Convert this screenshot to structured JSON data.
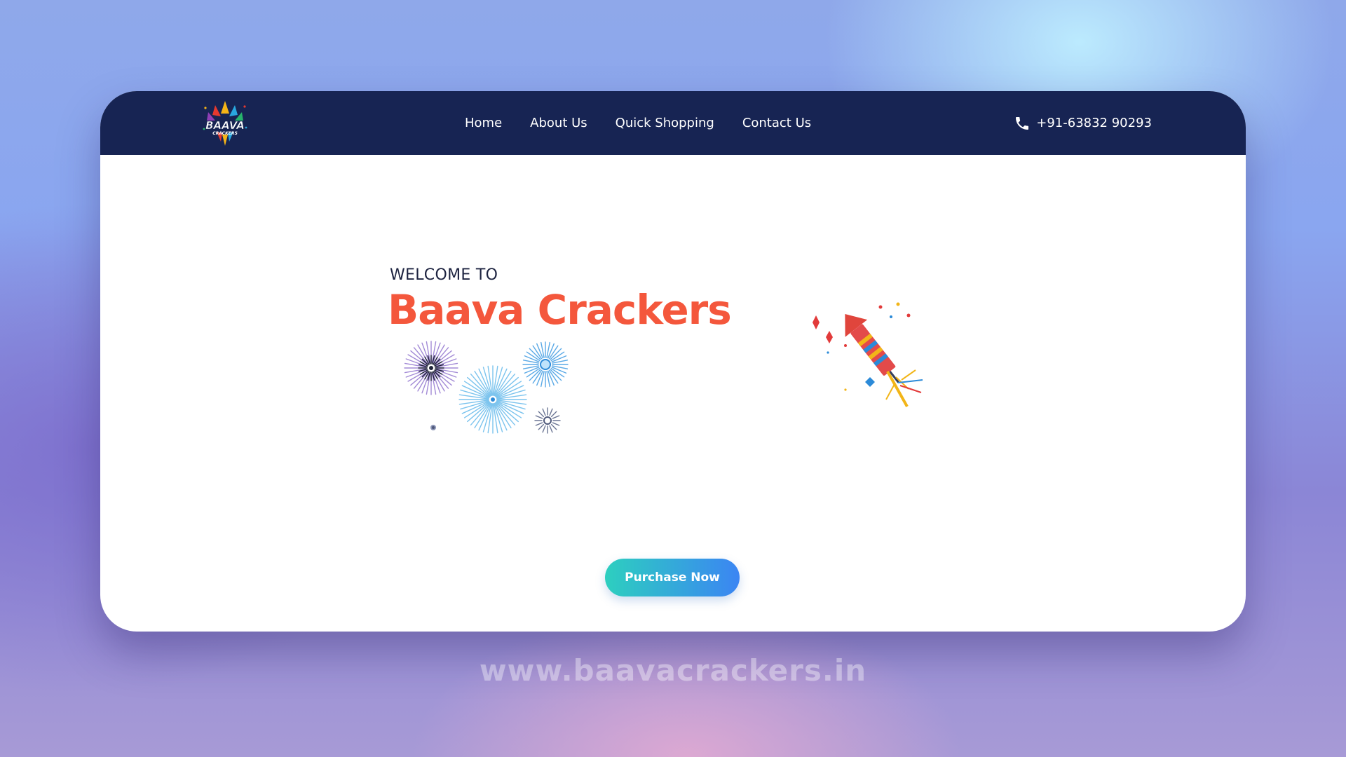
{
  "header": {
    "logo": {
      "icon": "baava-crackers-logo",
      "text": "BAAVA",
      "subtext": "CRACKERS"
    },
    "nav": [
      {
        "label": "Home"
      },
      {
        "label": "About Us"
      },
      {
        "label": "Quick Shopping"
      },
      {
        "label": "Contact Us"
      }
    ],
    "phone": {
      "icon": "phone-icon",
      "number": "+91-63832 90293"
    }
  },
  "hero": {
    "welcome": "WELCOME TO",
    "title": "Baava Crackers",
    "cta_label": "Purchase Now",
    "decorations": [
      "fireworks-illustration",
      "rocket-firecracker-illustration"
    ]
  },
  "footer": {
    "url": "www.baavacrackers.in"
  },
  "colors": {
    "nav_background": "#172453",
    "title": "#f4573c",
    "button_gradient_start": "#2dcfbf",
    "button_gradient_end": "#3b85f3"
  }
}
